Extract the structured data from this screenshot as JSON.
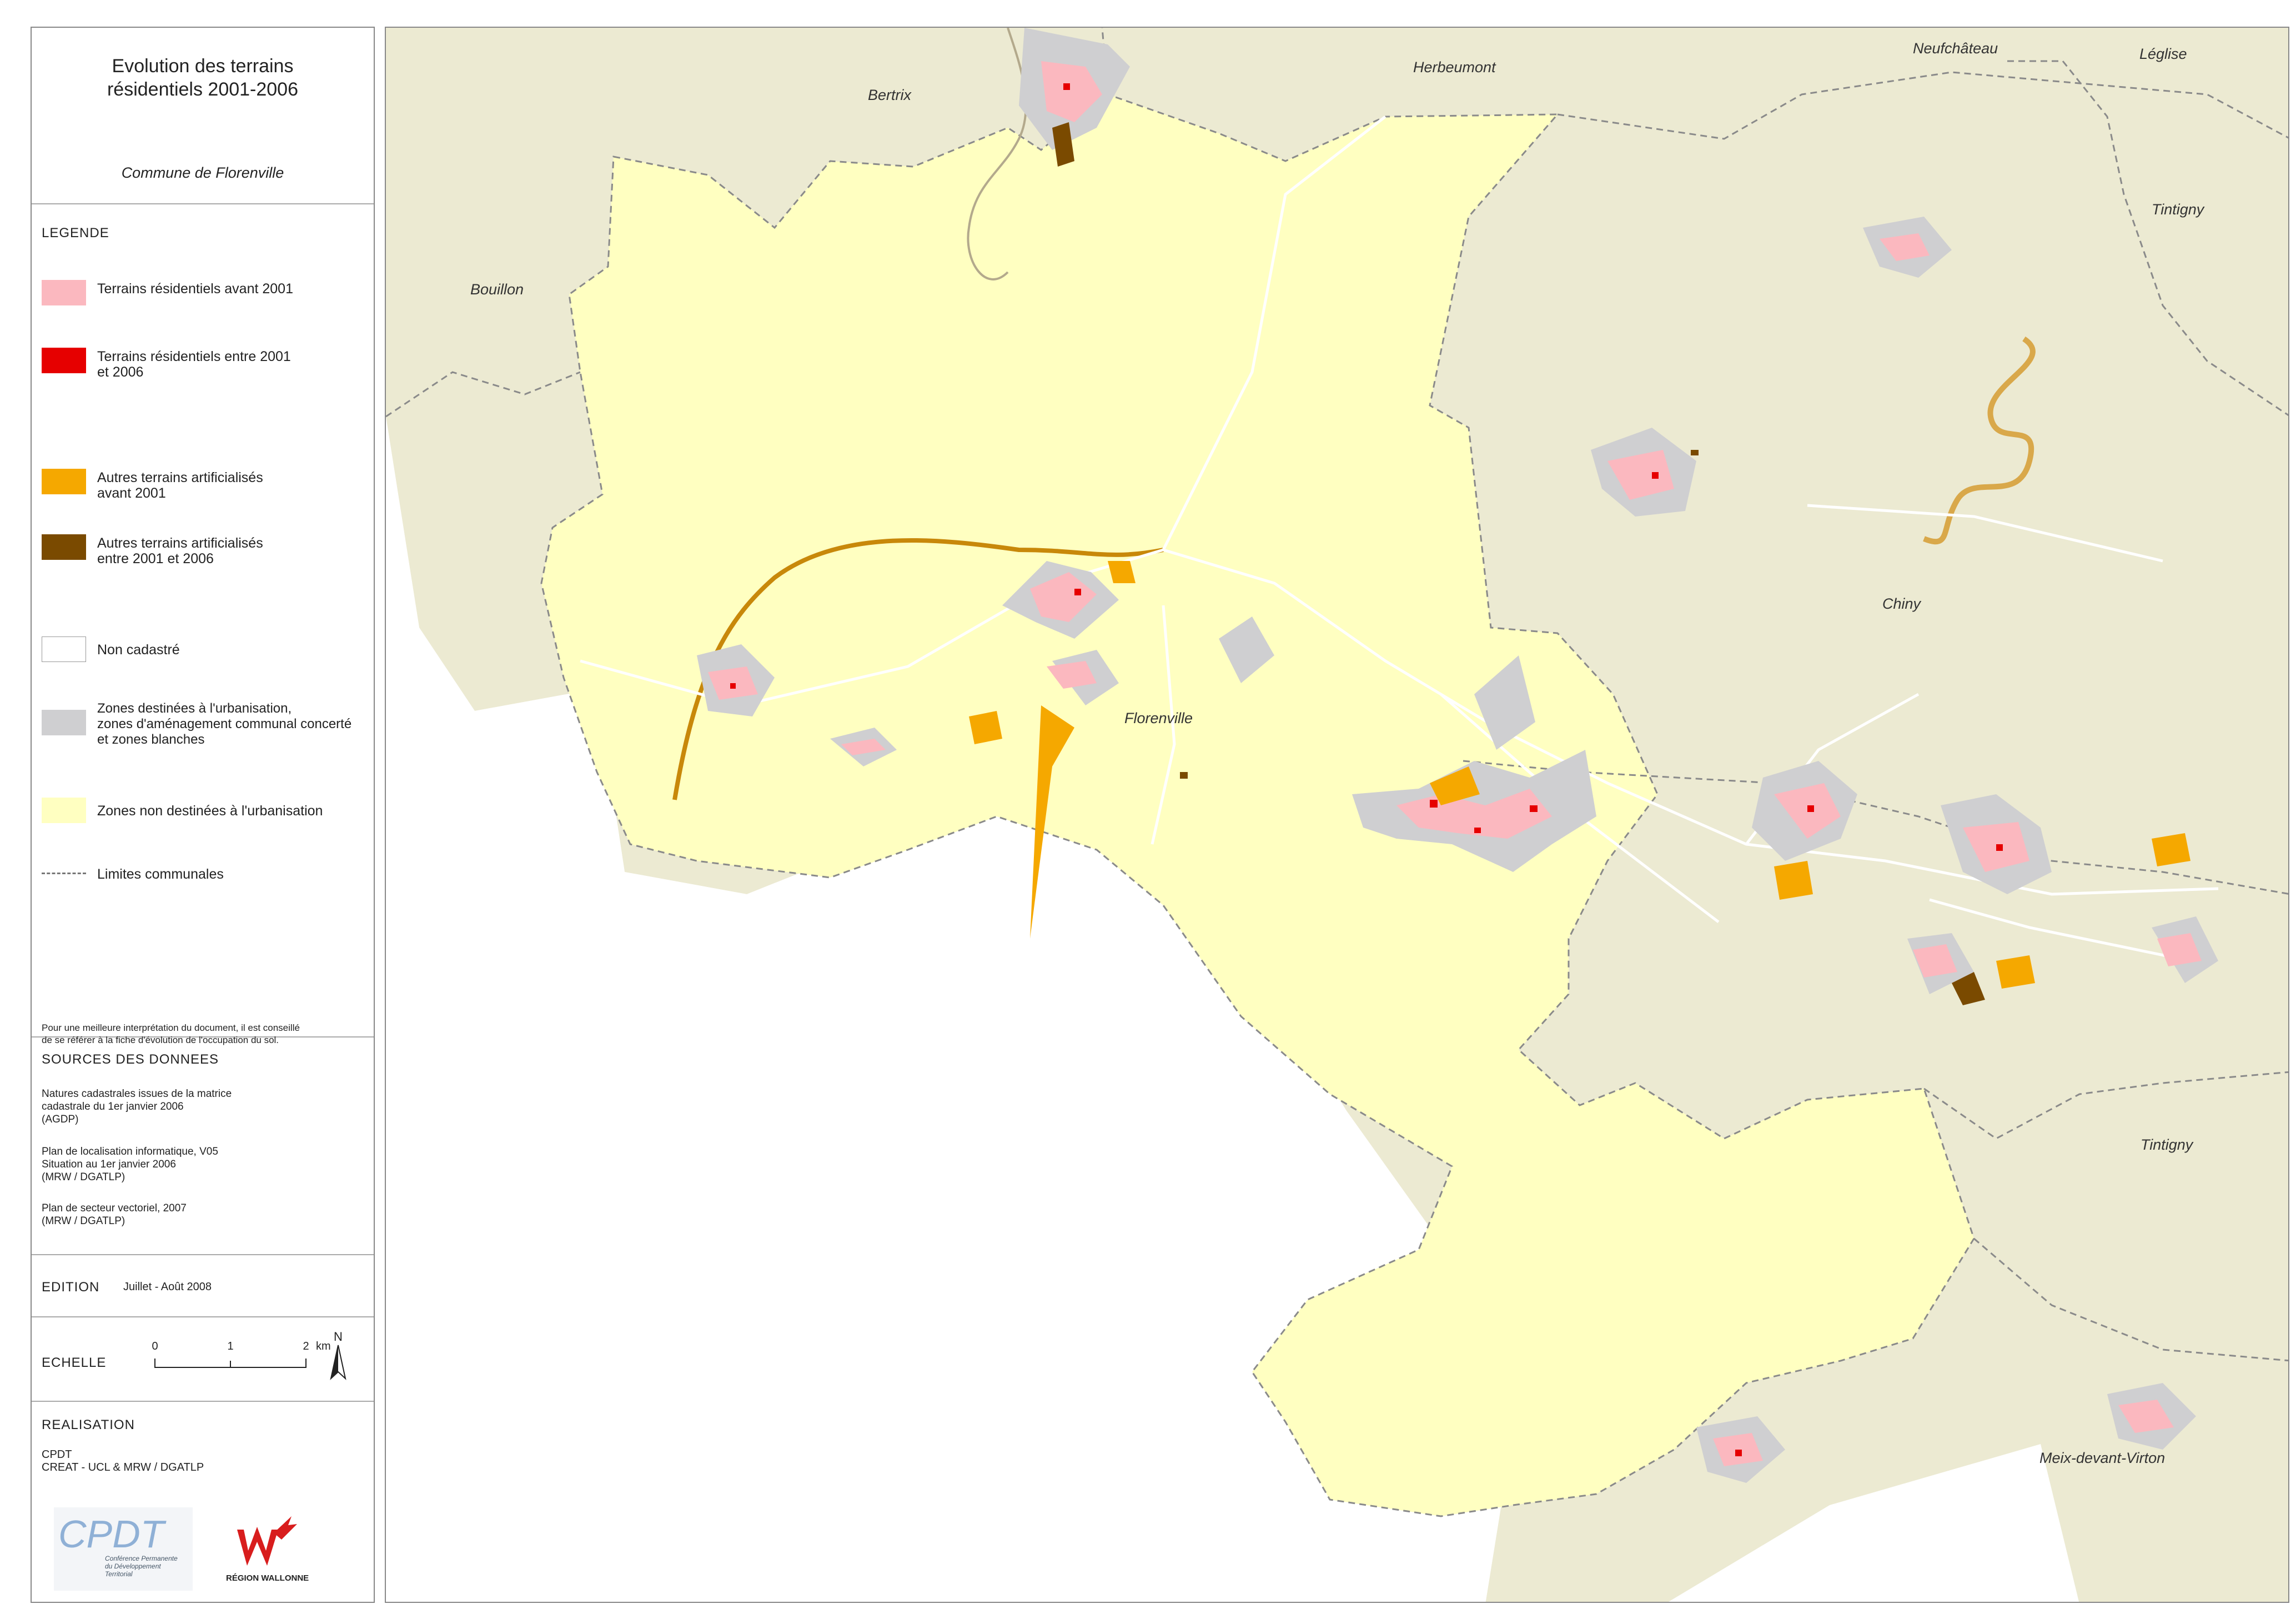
{
  "title": {
    "lines": [
      "Evolution des terrains",
      "résidentiels 2001-2006"
    ],
    "commune": "Commune de Florenville"
  },
  "legend": {
    "heading": "LEGENDE",
    "items": [
      {
        "lines": [
          "Terrains résidentiels avant 2001"
        ],
        "color": "#fbb8bf"
      },
      {
        "lines": [
          "Terrains résidentiels entre 2001",
          "et 2006"
        ],
        "color": "#e60000"
      },
      {
        "lines": [
          "Autres terrains artificialisés",
          "avant 2001"
        ],
        "color": "#f5a800"
      },
      {
        "lines": [
          "Autres terrains artificialisés",
          "entre 2001 et 2006"
        ],
        "color": "#7a4a00"
      },
      {
        "lines": [
          "Non cadastré"
        ],
        "color": "#ffffff"
      },
      {
        "lines": [
          "Zones destinées à l'urbanisation,",
          "zones d'aménagement communal concerté",
          "et zones blanches"
        ],
        "color": "#cfcfd1"
      },
      {
        "lines": [
          "Zones non destinées à l'urbanisation"
        ],
        "color": "#ffffc1"
      },
      {
        "lines": [
          "Limites communales"
        ],
        "color": "#777777"
      }
    ],
    "note": [
      "Pour une meilleure interprétation du document, il est conseillé",
      "de se référer à la fiche d'évolution de l'occupation du sol."
    ]
  },
  "sources": {
    "heading": "SOURCES DES DONNEES",
    "blocks": [
      [
        "Natures cadastrales issues de la matrice",
        "cadastrale du 1er janvier 2006",
        "(AGDP)"
      ],
      [
        "Plan de localisation informatique, V05",
        "Situation au 1er janvier 2006",
        "(MRW / DGATLP)"
      ],
      [
        "Plan de secteur vectoriel, 2007",
        "(MRW / DGATLP)"
      ]
    ]
  },
  "edition": {
    "label": "EDITION",
    "value": "Juillet - Août 2008"
  },
  "scale": {
    "label": "ECHELLE",
    "ticks": [
      "0",
      "1",
      "2"
    ],
    "unit": "km",
    "north": "N"
  },
  "realisation": {
    "heading": "REALISATION",
    "lines": [
      "CPDT",
      "CREAT - UCL & MRW / DGATLP"
    ],
    "logo_cpdt": {
      "text": "CPDT",
      "caption": [
        "Conférence Permanente",
        "du Développement",
        "Territorial"
      ]
    },
    "logo_rw": {
      "caption": "RÉGION WALLONNE"
    }
  },
  "map": {
    "colors": {
      "outside": "#ecead2",
      "commune": "#ffffc1",
      "urban": "#cfcfd1",
      "residential": "#fbb8bf",
      "new_residential": "#e60000",
      "artificial": "#f5a800",
      "new_artificial": "#7a4a00",
      "river": "#d9a84a",
      "border": "#888888"
    },
    "places": [
      {
        "name": "Bertrix"
      },
      {
        "name": "Herbeumont"
      },
      {
        "name": "Neufchâteau"
      },
      {
        "name": "Léglise"
      },
      {
        "name": "Tintigny"
      },
      {
        "name": "Bouillon"
      },
      {
        "name": "Chiny"
      },
      {
        "name": "Florenville"
      },
      {
        "name": "Tintigny"
      },
      {
        "name": "Meix-devant-Virton"
      }
    ]
  }
}
